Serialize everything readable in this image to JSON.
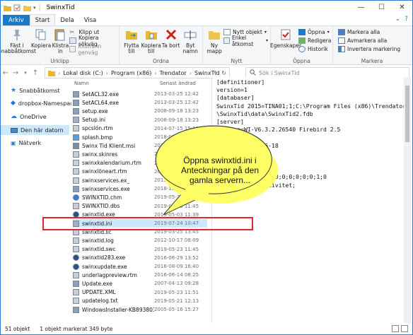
{
  "window": {
    "title": "SwinxTid"
  },
  "tabs": [
    {
      "label": "Arkiv"
    },
    {
      "label": "Start"
    },
    {
      "label": "Dela"
    },
    {
      "label": "Visa"
    }
  ],
  "ribbon": {
    "clipboard": {
      "label": "Urklipp",
      "pin": "Fäst i Snabbåtkomst",
      "copy": "Kopiera",
      "paste": "Klistra in",
      "cut": "Klipp ut",
      "copy_path": "Kopiera sökväg",
      "paste_shortcut": "Klistra in genväg"
    },
    "organize": {
      "label": "Ordna",
      "move_to": "Flytta till",
      "copy_to": "Kopiera till",
      "delete": "Ta bort",
      "rename": "Byt namn"
    },
    "new": {
      "label": "Nytt",
      "new_folder": "Ny mapp",
      "new_item": "Nytt objekt",
      "easy_access": "Enkel åtkomst"
    },
    "open": {
      "label": "Öppna",
      "properties": "Egenskaper",
      "open": "Öppna",
      "edit": "Redigera",
      "history": "Historik"
    },
    "select": {
      "label": "Markera",
      "select_all": "Markera alla",
      "select_none": "Avmarkera alla",
      "invert": "Invertera markering"
    }
  },
  "address": {
    "segments": [
      "Lokal disk (C:)",
      "Program (x86)",
      "Trendator",
      "SwinxTid"
    ],
    "search_placeholder": "Sök i SwinxTid"
  },
  "nav": [
    {
      "label": "Snabbåtkomst",
      "icon": "star-icon"
    },
    {
      "label": "dropbox-Namespac",
      "icon": "dropbox-icon"
    },
    {
      "label": "OneDrive",
      "icon": "cloud-icon"
    },
    {
      "label": "Den här datorn",
      "icon": "computer-icon"
    },
    {
      "label": "Nätverk",
      "icon": "network-icon"
    }
  ],
  "columns": {
    "name": "Namn",
    "date": "Senast ändrad"
  },
  "files": [
    {
      "name": "SetACL32.exe",
      "date": "2013-03-25 12:42",
      "icon": "exe-icon"
    },
    {
      "name": "SetACL64.exe",
      "date": "2013-03-25 12:42",
      "icon": "exe-icon"
    },
    {
      "name": "setup.exe",
      "date": "2008-09-18 13:23",
      "icon": "exe-icon"
    },
    {
      "name": "Setup.ini",
      "date": "2008-09-18 13:23",
      "icon": "ini-icon"
    },
    {
      "name": "spcslón.rtm",
      "date": "2014-07-15 15:11",
      "icon": "file-icon"
    },
    {
      "name": "splash.bmp",
      "date": "2018-01-05 12:47",
      "icon": "image-icon"
    },
    {
      "name": "Swinx Tid Klient.msi",
      "date": "2019-05-23 11:51",
      "icon": "msi-icon"
    },
    {
      "name": "swinx.skinres",
      "date": "2018-08-22 13:48",
      "icon": "file-icon"
    },
    {
      "name": "swinxkalendarium.rtm",
      "date": "2015-02-12 14:28",
      "icon": "file-icon"
    },
    {
      "name": "swinxlöneart.rtm",
      "date": "2013-08-14 15:21",
      "icon": "file-icon"
    },
    {
      "name": "swinxservices.ex_",
      "date": "2015-03-05 14:26",
      "icon": "file-icon"
    },
    {
      "name": "swinxservices.exe",
      "date": "2018-12-10 14:36",
      "icon": "exe-icon"
    },
    {
      "name": "SWINXTID.chm",
      "date": "2019-05-23 11:45",
      "icon": "help-icon"
    },
    {
      "name": "SWINXTID.dbs",
      "date": "2019-05-23 11:45",
      "icon": "file-icon"
    },
    {
      "name": "swinxtid.exe",
      "date": "2019-05-03 11:39",
      "icon": "app-icon"
    },
    {
      "name": "swinxtid.ini",
      "date": "2019-07-24 10:47",
      "icon": "ini-icon",
      "selected": true
    },
    {
      "name": "swinxtid.lic",
      "date": "2019-03-25 13:45",
      "icon": "file-icon"
    },
    {
      "name": "swinxtid.log",
      "date": "2012-10-17 08:09",
      "icon": "file-icon"
    },
    {
      "name": "swinxtid.swc",
      "date": "2019-05-23 11:45",
      "icon": "file-icon"
    },
    {
      "name": "swinxtid283.exe",
      "date": "2016-06-29 13:52",
      "icon": "app-icon"
    },
    {
      "name": "swinxupdate.exe",
      "date": "2016-08-09 16:40",
      "icon": "app-icon"
    },
    {
      "name": "underlagpreview.rtm",
      "date": "2016-06-14 08:25",
      "icon": "file-icon"
    },
    {
      "name": "Update.exe",
      "date": "2007-04-13 09:28",
      "icon": "exe-icon"
    },
    {
      "name": "UPDATE.XML",
      "date": "2019-05-23 11:51",
      "icon": "file-icon"
    },
    {
      "name": "updatelog.txt",
      "date": "2019-05-21 12:13",
      "icon": "file-icon"
    },
    {
      "name": "WindowsInstaller-KB893803-x8...",
      "date": "2005-05-16 15:27",
      "icon": "exe-icon"
    }
  ],
  "preview": {
    "lines": [
      "[definitioner]",
      "version=1",
      "[databaser]",
      "SwinxTid 2015=TINA01;1;C:\\Program Files (x86)\\Trendator",
      "\\SwinxTid\\data\\SwinxTid2.fdb",
      "[server]",
      "version=WI-V6.3.2.26540 Firebird 2.5",
      "[update]",
      "checked=2019-06-18",
      "",
      "",
      "",
      ";0;0;0;0;0;1;0;0;0;0;0;0;0;0;1;0",
      "it;Datum;Tid;Aktivitet;",
      "",
      "",
      "",
      ""
    ]
  },
  "status": {
    "count": "51 objekt",
    "selection": "1 objekt markerat  349 byte"
  },
  "callout": {
    "text": "Öppna swinxtid.ini i Anteckningar på den gamla servern..."
  },
  "colors": {
    "accent": "#1979ca",
    "highlight": "#e0262b",
    "bubble": "#ffff66",
    "selected_bg": "#cce8ff"
  }
}
